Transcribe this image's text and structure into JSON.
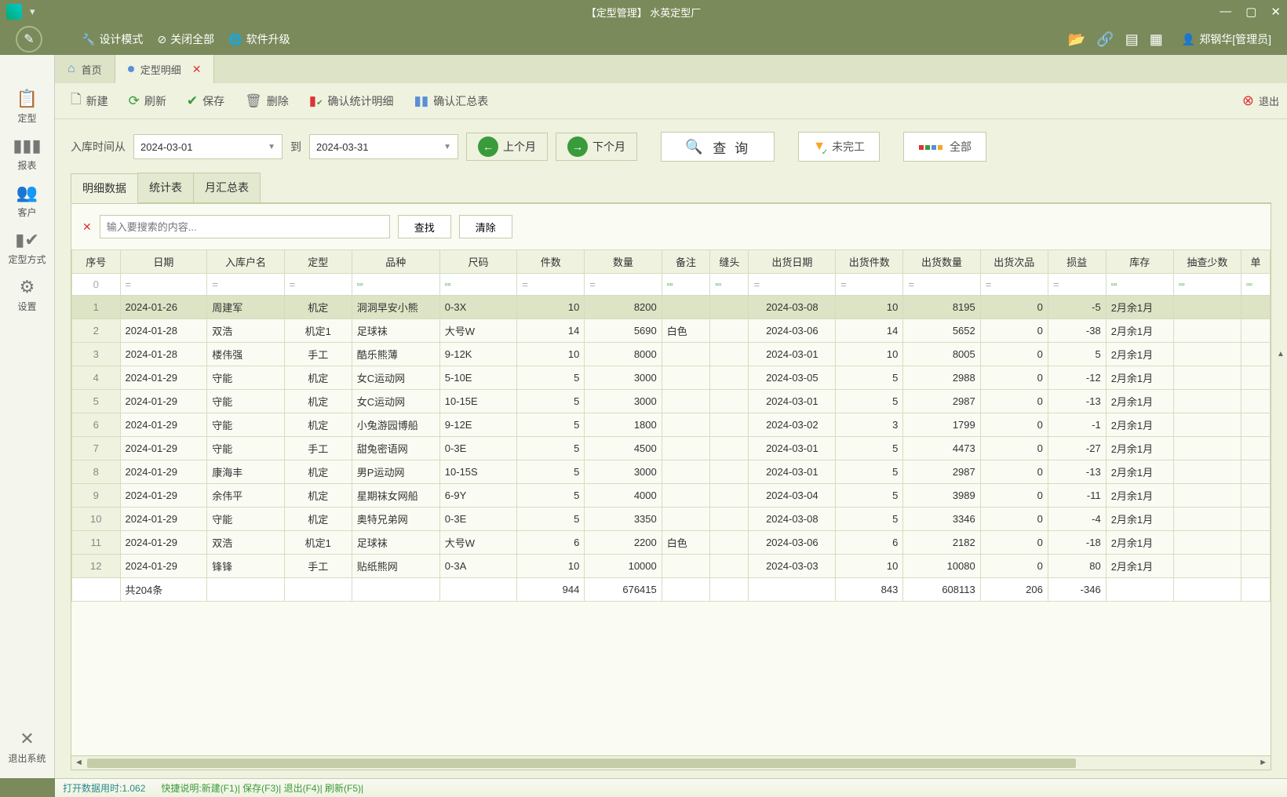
{
  "titlebar": {
    "title": "【定型管理】 水英定型厂"
  },
  "menubar": {
    "design": "设计模式",
    "closeAll": "关闭全部",
    "upgrade": "软件升级",
    "user": "郑钢华[管理员]"
  },
  "tabs": {
    "home": "首页",
    "detail": "定型明细"
  },
  "toolbar": {
    "new": "新建",
    "refresh": "刷新",
    "save": "保存",
    "delete": "删除",
    "confirmDetail": "确认统计明细",
    "confirmSummary": "确认汇总表",
    "exit": "退出"
  },
  "sidebar": {
    "shaping": "定型",
    "report": "报表",
    "customer": "客户",
    "method": "定型方式",
    "settings": "设置",
    "exitSys": "退出系统"
  },
  "filter": {
    "fromLabel": "入库时间从",
    "from": "2024-03-01",
    "toLabel": "到",
    "to": "2024-03-31",
    "prevMonth": "上个月",
    "nextMonth": "下个月",
    "query": "查 询",
    "incomplete": "未完工",
    "all": "全部"
  },
  "dataTabs": {
    "detail": "明细数据",
    "stats": "统计表",
    "monthly": "月汇总表"
  },
  "search": {
    "placeholder": "输入要搜索的内容...",
    "find": "查找",
    "clear": "清除"
  },
  "columns": [
    "序号",
    "日期",
    "入库户名",
    "定型",
    "品种",
    "尺码",
    "件数",
    "数量",
    "备注",
    "缝头",
    "出货日期",
    "出货件数",
    "出货数量",
    "出货次品",
    "损益",
    "库存",
    "抽查少数",
    "单"
  ],
  "rows": [
    {
      "idx": 1,
      "date": "2024-01-26",
      "name": "周建军",
      "type": "机定",
      "product": "洞洞早安小熊",
      "size": "0-3X",
      "pieces": 10,
      "qty": 8200,
      "note": "",
      "seam": "",
      "shipDate": "2024-03-08",
      "shipPieces": 10,
      "shipQty": 8195,
      "defect": 0,
      "pl": -5,
      "stock": "2月余1月"
    },
    {
      "idx": 2,
      "date": "2024-01-28",
      "name": "双浩",
      "type": "机定1",
      "product": "足球袜",
      "size": "大号W",
      "pieces": 14,
      "qty": 5690,
      "note": "白色",
      "seam": "",
      "shipDate": "2024-03-06",
      "shipPieces": 14,
      "shipQty": 5652,
      "defect": 0,
      "pl": -38,
      "stock": "2月余1月"
    },
    {
      "idx": 3,
      "date": "2024-01-28",
      "name": "楼伟强",
      "type": "手工",
      "product": "酷乐熊薄",
      "size": "9-12K",
      "pieces": 10,
      "qty": 8000,
      "note": "",
      "seam": "",
      "shipDate": "2024-03-01",
      "shipPieces": 10,
      "shipQty": 8005,
      "defect": 0,
      "pl": 5,
      "stock": "2月余1月"
    },
    {
      "idx": 4,
      "date": "2024-01-29",
      "name": "守能",
      "type": "机定",
      "product": "女C运动网",
      "size": "5-10E",
      "pieces": 5,
      "qty": 3000,
      "note": "",
      "seam": "",
      "shipDate": "2024-03-05",
      "shipPieces": 5,
      "shipQty": 2988,
      "defect": 0,
      "pl": -12,
      "stock": "2月余1月"
    },
    {
      "idx": 5,
      "date": "2024-01-29",
      "name": "守能",
      "type": "机定",
      "product": "女C运动网",
      "size": "10-15E",
      "pieces": 5,
      "qty": 3000,
      "note": "",
      "seam": "",
      "shipDate": "2024-03-01",
      "shipPieces": 5,
      "shipQty": 2987,
      "defect": 0,
      "pl": -13,
      "stock": "2月余1月"
    },
    {
      "idx": 6,
      "date": "2024-01-29",
      "name": "守能",
      "type": "机定",
      "product": "小兔游园博船",
      "size": "9-12E",
      "pieces": 5,
      "qty": 1800,
      "note": "",
      "seam": "",
      "shipDate": "2024-03-02",
      "shipPieces": 3,
      "shipQty": 1799,
      "defect": 0,
      "pl": -1,
      "stock": "2月余1月"
    },
    {
      "idx": 7,
      "date": "2024-01-29",
      "name": "守能",
      "type": "手工",
      "product": "甜兔密语网",
      "size": "0-3E",
      "pieces": 5,
      "qty": 4500,
      "note": "",
      "seam": "",
      "shipDate": "2024-03-01",
      "shipPieces": 5,
      "shipQty": 4473,
      "defect": 0,
      "pl": -27,
      "stock": "2月余1月"
    },
    {
      "idx": 8,
      "date": "2024-01-29",
      "name": "康海丰",
      "type": "机定",
      "product": "男P运动网",
      "size": "10-15S",
      "pieces": 5,
      "qty": 3000,
      "note": "",
      "seam": "",
      "shipDate": "2024-03-01",
      "shipPieces": 5,
      "shipQty": 2987,
      "defect": 0,
      "pl": -13,
      "stock": "2月余1月"
    },
    {
      "idx": 9,
      "date": "2024-01-29",
      "name": "余伟平",
      "type": "机定",
      "product": "星期袜女网船",
      "size": "6-9Y",
      "pieces": 5,
      "qty": 4000,
      "note": "",
      "seam": "",
      "shipDate": "2024-03-04",
      "shipPieces": 5,
      "shipQty": 3989,
      "defect": 0,
      "pl": -11,
      "stock": "2月余1月"
    },
    {
      "idx": 10,
      "date": "2024-01-29",
      "name": "守能",
      "type": "机定",
      "product": "奥特兄弟网",
      "size": "0-3E",
      "pieces": 5,
      "qty": 3350,
      "note": "",
      "seam": "",
      "shipDate": "2024-03-08",
      "shipPieces": 5,
      "shipQty": 3346,
      "defect": 0,
      "pl": -4,
      "stock": "2月余1月"
    },
    {
      "idx": 11,
      "date": "2024-01-29",
      "name": "双浩",
      "type": "机定1",
      "product": "足球袜",
      "size": "大号W",
      "pieces": 6,
      "qty": 2200,
      "note": "白色",
      "seam": "",
      "shipDate": "2024-03-06",
      "shipPieces": 6,
      "shipQty": 2182,
      "defect": 0,
      "pl": -18,
      "stock": "2月余1月"
    },
    {
      "idx": 12,
      "date": "2024-01-29",
      "name": "锋锋",
      "type": "手工",
      "product": "贴纸熊网",
      "size": "0-3A",
      "pieces": 10,
      "qty": 10000,
      "note": "",
      "seam": "",
      "shipDate": "2024-03-03",
      "shipPieces": 10,
      "shipQty": 10080,
      "defect": 0,
      "pl": 80,
      "stock": "2月余1月"
    }
  ],
  "totals": {
    "label": "共204条",
    "pieces": 944,
    "qty": 676415,
    "shipPieces": 843,
    "shipQty": 608113,
    "defect": 206,
    "pl": -346
  },
  "status": {
    "timing": "打开数据用时:1.062",
    "hint": "快捷说明:新建(F1)| 保存(F3)| 退出(F4)| 刷新(F5)|"
  }
}
